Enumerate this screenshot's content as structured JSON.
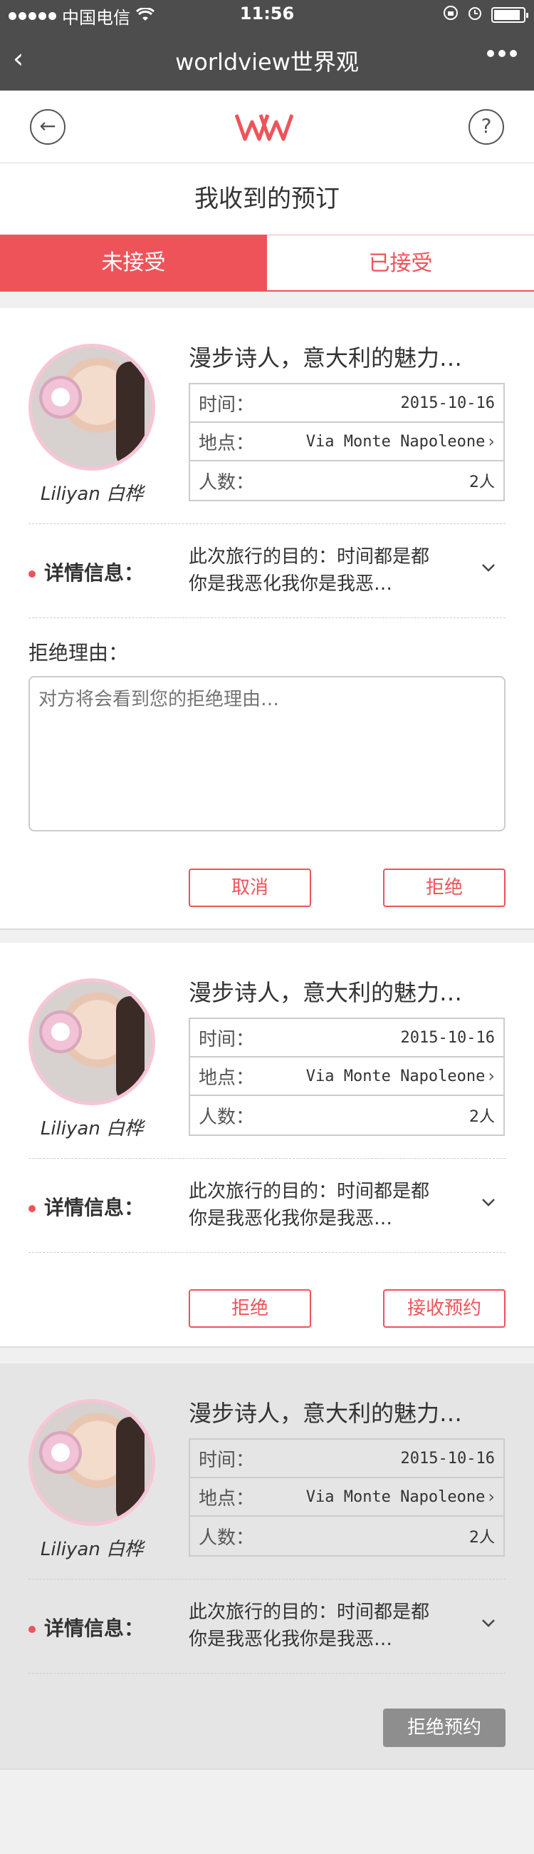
{
  "status": {
    "carrier": "中国电信",
    "time": "11:56"
  },
  "nav": {
    "back_glyph": "‹",
    "title": "worldview世界观",
    "more": "more-icon"
  },
  "header": {
    "left_icon": "back-circle-icon",
    "left_glyph": "←",
    "logo": "WV",
    "right_icon": "help-icon",
    "right_glyph": "?"
  },
  "page_title": "我收到的预订",
  "tabs": [
    {
      "label": "未接受",
      "active": true
    },
    {
      "label": "已接受",
      "active": false
    }
  ],
  "cards": [
    {
      "author": "Liliyan 白桦",
      "title": "漫步诗人，意大利的魅力…",
      "time_label": "时间：",
      "time": "2015-10-16",
      "place_label": "地点：",
      "place": "Via Monte Napoleone",
      "people_label": "人数：",
      "people": "2人",
      "detail_label": "详情信息：",
      "detail_line1": "此次旅行的目的：时间都是都",
      "detail_line2": "你是我恶化我你是我恶…",
      "reason_label": "拒绝理由：",
      "reason_placeholder": "对方将会看到您的拒绝理由…",
      "btn1": "取消",
      "btn2": "拒绝"
    },
    {
      "author": "Liliyan 白桦",
      "title": "漫步诗人，意大利的魅力…",
      "time_label": "时间：",
      "time": "2015-10-16",
      "place_label": "地点：",
      "place": "Via Monte Napoleone",
      "people_label": "人数：",
      "people": "2人",
      "detail_label": "详情信息：",
      "detail_line1": "此次旅行的目的：时间都是都",
      "detail_line2": "你是我恶化我你是我恶…",
      "btn1": "拒绝",
      "btn2": "接收预约"
    },
    {
      "author": "Liliyan 白桦",
      "title": "漫步诗人，意大利的魅力…",
      "time_label": "时间：",
      "time": "2015-10-16",
      "place_label": "地点：",
      "place": "Via Monte Napoleone",
      "people_label": "人数：",
      "people": "2人",
      "detail_label": "详情信息：",
      "detail_line1": "此次旅行的目的：时间都是都",
      "detail_line2": "你是我恶化我你是我恶…",
      "btn1": "拒绝预约"
    }
  ],
  "colors": {
    "accent": "#ef535a",
    "bar": "#4d4d4d",
    "disabled": "#8e8e8e"
  }
}
